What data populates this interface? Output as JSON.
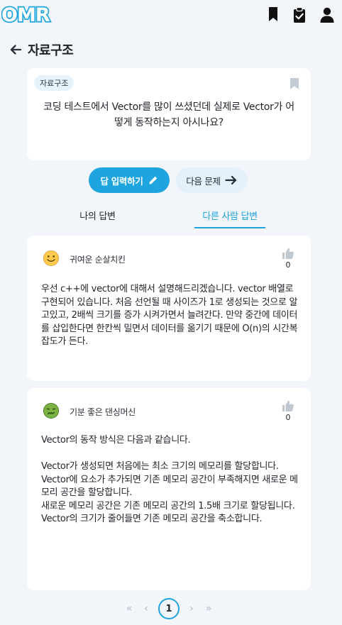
{
  "header": {
    "logo_text": "OMR",
    "icons": [
      "bookmark-icon",
      "clipboard-check-icon",
      "user-icon"
    ]
  },
  "page": {
    "title": "자료구조"
  },
  "question": {
    "tag": "자료구조",
    "text": "코딩 테스트에서 Vector를 많이 쓰셨던데 실제로 Vector가 어떻게 동작하는지 아시나요?"
  },
  "actions": {
    "answer_label": "답 입력하기",
    "next_label": "다음 문제"
  },
  "tabs": {
    "mine": "나의 답변",
    "others": "다른 사람 답변"
  },
  "answers": [
    {
      "user": "귀여운 순살치킨",
      "avatar": "smile-face-icon",
      "likes": "0",
      "body": [
        "우선 c++에 vector에 대해서 설명해드리겠습니다. vector 배열로 구현되어 있습니다. 처음 선언될 때 사이즈가 1로 생성되는 것으로 알고있고, 2배씩 크기를 증가 시켜가면서 늘려간다. 만약 중간에 데이터를 삽입한다면 한칸씩 밀면서 데이터를 옮기기 때문에 O(n)의 시간복잡도가 든다."
      ]
    },
    {
      "user": "기분 좋은 댄싱머신",
      "avatar": "sick-face-icon",
      "likes": "0",
      "body": [
        "Vector의 동작 방식은 다음과 같습니다.",
        "",
        "Vector가 생성되면 처음에는 최소 크기의 메모리를 할당합니다.",
        "Vector에 요소가 추가되면 기존 메모리 공간이 부족해지면 새로운 메모리 공간을 할당합니다.",
        "새로운 메모리 공간은 기존 메모리 공간의 1.5배 크기로 할당됩니다.",
        "Vector의 크기가 줄어들면 기존 메모리 공간을 축소합니다."
      ]
    }
  ],
  "pagination": {
    "first": "«",
    "prev": "‹",
    "current": "1",
    "next": "›",
    "last": "»"
  },
  "colors": {
    "accent": "#1ea5e0",
    "background": "#f2f5f9",
    "card": "#ffffff"
  }
}
